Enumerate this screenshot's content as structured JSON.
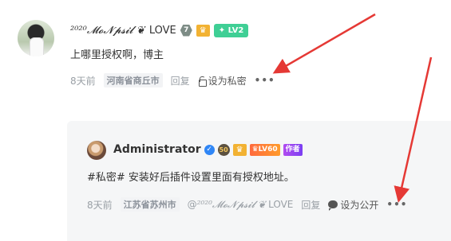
{
  "comment": {
    "username": "²⁰²⁰𝓜𝓸𝓝𝓹𝓼𝓲𝓵 ❦",
    "username_suffix": "LOVE",
    "badges": {
      "level_num": "7",
      "crown": "♛",
      "lv": "✦ LV2"
    },
    "content": "上哪里授权啊，博主",
    "time": "8天前",
    "location": "河南省商丘市",
    "reply_label": "回复",
    "privacy_label": "设为私密",
    "more_label": "•••"
  },
  "reply": {
    "username": "Administrator",
    "badges": {
      "verified": "✓",
      "level_num": "50",
      "crown": "♛",
      "vip": "♛LV60",
      "author": "作者"
    },
    "content": "#私密# 安装好后插件设置里面有授权地址。",
    "time": "8天前",
    "location": "江苏省苏州市",
    "mention_prefix": "@",
    "mention_name": "²⁰²⁰𝓜𝓸𝓝𝓹𝓼𝓲𝓵 ❦",
    "mention_suffix": "LOVE",
    "reply_label": "回复",
    "privacy_label": "设为公开",
    "more_label": "•••"
  },
  "colors": {
    "arrow": "#e53935",
    "lv_badge": "#3fcf95",
    "verified": "#2f86f6"
  }
}
